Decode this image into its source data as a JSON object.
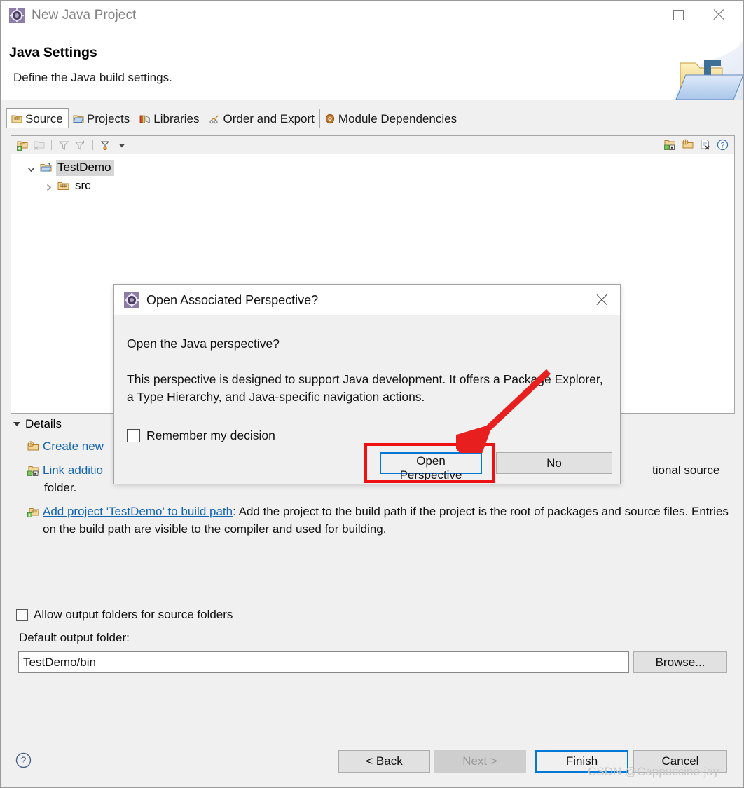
{
  "window": {
    "title": "New Java Project",
    "icon": "eclipse-wizard-icon",
    "minimize_label": "Minimize",
    "maximize_label": "Maximize",
    "close_label": "Close"
  },
  "header": {
    "title": "Java Settings",
    "subtitle": "Define the Java build settings.",
    "banner_icon": "java-project-folder-icon"
  },
  "tabs": [
    {
      "label": "Source",
      "icon": "source-folder-icon",
      "active": true
    },
    {
      "label": "Projects",
      "icon": "projects-folder-icon",
      "active": false
    },
    {
      "label": "Libraries",
      "icon": "libraries-icon",
      "active": false
    },
    {
      "label": "Order and Export",
      "icon": "order-export-icon",
      "active": false
    },
    {
      "label": "Module Dependencies",
      "icon": "module-dependencies-icon",
      "active": false
    }
  ],
  "source_panel": {
    "toolbar_left": [
      {
        "name": "add-source-folder-icon",
        "title": "Add Folder"
      },
      {
        "name": "remove-source-folder-icon",
        "title": "Remove"
      },
      {
        "name": "filter-icon",
        "title": "Filters"
      },
      {
        "name": "filter-add-icon",
        "title": "Add Filter"
      },
      {
        "name": "collapse-filter-icon",
        "title": "Collapse"
      },
      {
        "name": "dropdown-arrow-icon",
        "title": "Menu"
      }
    ],
    "toolbar_right": [
      {
        "name": "link-source-icon",
        "title": "Link Source"
      },
      {
        "name": "add-folder-icon",
        "title": "Add Folder"
      },
      {
        "name": "remove-entry-icon",
        "title": "Remove"
      },
      {
        "name": "help-icon",
        "title": "Help"
      }
    ],
    "tree": [
      {
        "label": "TestDemo",
        "icon": "java-project-icon",
        "expanded": true,
        "selected": true,
        "level": 1
      },
      {
        "label": "src",
        "icon": "source-folder-icon",
        "expanded": false,
        "selected": false,
        "level": 2
      }
    ]
  },
  "details": {
    "title": "Details",
    "expanded": true,
    "items": [
      {
        "icon": "create-folder-icon",
        "link": "Create new ",
        "rest": "",
        "truncated": true
      },
      {
        "icon": "link-folder-icon",
        "link": "Link additio",
        "rest": "tional source",
        "line2": "folder.",
        "truncated": true
      },
      {
        "icon": "add-project-icon",
        "link": "Add project 'TestDemo' to build path",
        "rest": ": Add the project to the build path if the project is the root of packages and source files. Entries on the build path are visible to the compiler and used for building.",
        "truncated": false
      }
    ]
  },
  "options": {
    "allow_output_folders_label": "Allow output folders for source folders",
    "allow_output_folders_checked": false,
    "default_output_folder_label": "Default output folder:",
    "default_output_folder_value": "TestDemo/bin",
    "browse_label": "Browse..."
  },
  "footer": {
    "help_icon": "help-circle-icon",
    "back_label": "< Back",
    "next_label": "Next >",
    "next_enabled": false,
    "finish_label": "Finish",
    "finish_default": true,
    "cancel_label": "Cancel"
  },
  "watermark": "CSDN @Cappuccino-jay",
  "modal": {
    "title": "Open Associated Perspective?",
    "icon": "eclipse-wizard-icon",
    "close_label": "Close",
    "question": "Open the Java perspective?",
    "description": "This perspective is designed to support Java development. It offers a Package Explorer, a Type Hierarchy, and Java-specific navigation actions.",
    "remember_label": "Remember my decision",
    "remember_checked": false,
    "open_button_label": "Open Perspective",
    "no_button_label": "No"
  },
  "annotations": {
    "highlight_color": "#ee1111",
    "arrow_color": "#e81f1f",
    "target": "Open Perspective"
  },
  "colors": {
    "accent_blue": "#0078d7",
    "link_blue": "#1264b0",
    "dialog_bg": "#f0f0f0",
    "panel_bg": "#ffffff",
    "border_gray": "#a6a6a6"
  }
}
